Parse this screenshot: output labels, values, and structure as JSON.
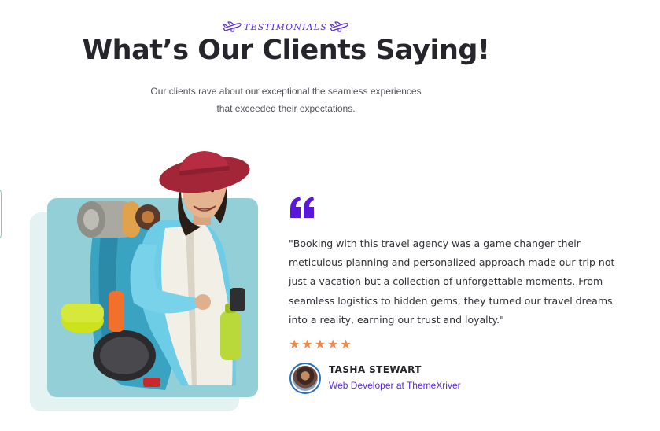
{
  "section": {
    "eyebrow": "TESTIMONIALS",
    "title": "What’s Our Clients Saying!",
    "subtitle_line1": "Our clients rave about our exceptional the seamless experiences",
    "subtitle_line2": "that exceeded their expectations.",
    "icons": {
      "eyebrow_left": "airplane-icon",
      "eyebrow_right": "airplane-icon",
      "quote": "quote-mark-icon",
      "rating": "star-icon"
    }
  },
  "testimonial": {
    "quote": "\"Booking with this travel agency was a game changer their meticulous planning and personalized approach made our trip not just a vacation but a collection of unforgettable moments. From seamless logistics to hidden gems, they turned our travel dreams into a reality, earning our trust and loyalty.\"",
    "rating": 5,
    "rating_max": 5,
    "author_name": "TASHA STEWART",
    "author_role": "Web Developer at ThemeXriver"
  },
  "colors": {
    "accent_purple": "#5b2bd6",
    "star_orange": "#ef8b4a",
    "photo_bg": "#93cfd7",
    "card_back": "#e4f2f1",
    "heading": "#25252b"
  }
}
